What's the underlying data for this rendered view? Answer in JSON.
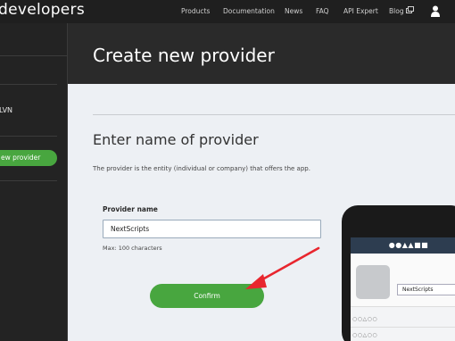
{
  "header": {
    "brand": "developers",
    "nav": [
      "Products",
      "Documentation",
      "News",
      "FAQ",
      "API Expert",
      "Blog"
    ]
  },
  "sidebar": {
    "name": "LVN",
    "active_item": "ew provider"
  },
  "page": {
    "title": "Create new provider"
  },
  "form": {
    "section_title": "Enter name of provider",
    "description": "The provider is the entity (individual or company) that offers the app.",
    "field_label": "Provider name",
    "field_value": "NextScripts",
    "field_hint": "Max: 100 characters",
    "confirm_label": "Confirm"
  },
  "phone_preview": {
    "bar_text": "●●▲▲■■",
    "field_value": "NextScripts",
    "row1": "○○△○○",
    "row2": "○○△○○"
  },
  "colors": {
    "accent_green": "#48a63f",
    "arrow_red": "#e8262e",
    "header_dark": "#1f1f1f",
    "content_bg": "#edf0f4"
  }
}
